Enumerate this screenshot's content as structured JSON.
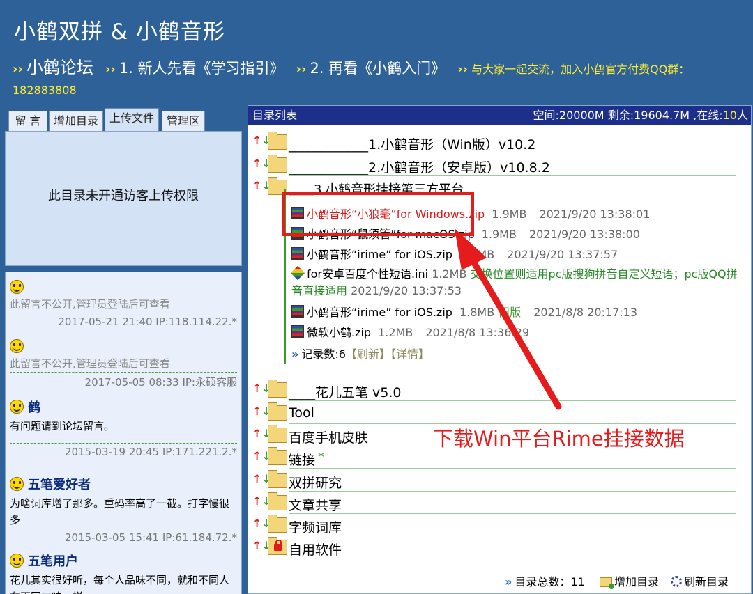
{
  "header": {
    "title": "小鹤双拼 & 小鹤音形",
    "chevron": "››",
    "nav_main": "小鹤论坛",
    "nav_link1": "1. 新人先看《学习指引》",
    "nav_link2": "2. 再看《小鹤入门》",
    "nav_qq": "与大家一起交流，加入小鹤官方付费QQ群：182883808"
  },
  "left_tabs": [
    "留 言",
    "增加目录",
    "上传文件",
    "管理区"
  ],
  "upload_message": "此目录未开通访客上传权限",
  "messages": [
    {
      "author": "",
      "text": "此留言不公开,管理员登陆后可查看",
      "meta": "2017-05-21 21:40 IP:118.114.22.*"
    },
    {
      "author": "",
      "text": "此留言不公开,管理员登陆后可查看",
      "meta": "2017-05-05 08:33 IP:永硕客服"
    },
    {
      "author": "鹤",
      "text": "有问题请到论坛留言。",
      "meta": "2015-03-19 20:45 IP:171.221.2.*"
    },
    {
      "author": "五笔爱好者",
      "text": "为啥词库增了那多。重码率高了一截。打字慢很多",
      "meta": "2015-03-05 15:41 IP:61.184.72.*"
    },
    {
      "author": "五笔用户",
      "text": "花儿其实很好听，每个人品味不同，就和不同人有不同口味一样",
      "meta": ""
    }
  ],
  "dir_bar": {
    "title": "目录列表",
    "stats_prefix": "空间:20000M 剩余:19604.7M ,在线:",
    "online": "10",
    "stats_suffix": "人"
  },
  "folders_top": [
    "____________1.小鹤音形（Win版）v10.2",
    "____________2.小鹤音形（安卓版）v10.8.2",
    "____3.小鹤音形挂接第三方平台"
  ],
  "files": [
    {
      "name": "小鹤音形“小狼毫”for Windows.zip",
      "size": "1.9MB",
      "date": "2021/9/20 13:38:01",
      "tag": "",
      "icon": "zip-icon"
    },
    {
      "name": "小鹤音形“鼠须管”for macOS.zip",
      "size": "1.9MB",
      "date": "2021/9/20 13:38:00",
      "tag": "",
      "icon": "zip-icon"
    },
    {
      "name": "小鹤音形“irime” for iOS.zip",
      "size": "1.9MB",
      "date": "2021/9/20 13:37:57",
      "tag": "",
      "icon": "zip-icon"
    },
    {
      "name": "小鹤音形“irime” for iOS.zip",
      "size": "1.8MB",
      "date": "2021/8/8 20:17:13",
      "tag": "旧版",
      "icon": "zip-icon"
    },
    {
      "name": "微软小鹤.zip",
      "size": "1.2MB",
      "date": "2021/8/8 13:36:29",
      "tag": "",
      "icon": "zip-icon"
    }
  ],
  "ini_file": {
    "name": "for安卓百度个性短语.ini",
    "size": "1.2MB",
    "desc": "交换位置则适用pc版搜狗拼音自定义短语；pc版QQ拼音直接适用",
    "date": "2021/9/20 13:37:53"
  },
  "record_count": {
    "label": "记录数:6",
    "refresh": "【刷新】",
    "detail": "【详情】"
  },
  "folders_bottom": [
    {
      "name": "____花儿五笔 v5.0",
      "star": "",
      "locked": false
    },
    {
      "name": "Tool",
      "star": "",
      "locked": false
    },
    {
      "name": "百度手机皮肤",
      "star": "",
      "locked": false
    },
    {
      "name": "链接",
      "star": "*",
      "locked": false
    },
    {
      "name": "双拼研究",
      "star": "",
      "locked": false
    },
    {
      "name": "文章共享",
      "star": "",
      "locked": false
    },
    {
      "name": "字频词库",
      "star": "",
      "locked": false
    },
    {
      "name": "自用软件",
      "star": "",
      "locked": true
    }
  ],
  "annotation": "下载Win平台Rime挂接数据",
  "footer": {
    "total": "目录总数：11",
    "add": "增加目录",
    "refresh": "刷新目录"
  },
  "colors": {
    "header_bg": "#2f6199",
    "accent_yellow": "#ffee33",
    "annotation_red": "#e61c1c",
    "dir_bar_bg": "#1c2f8a"
  }
}
